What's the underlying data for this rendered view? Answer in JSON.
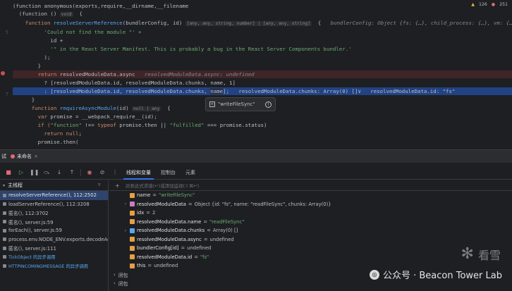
{
  "editor": {
    "status": {
      "warnings": "126",
      "errors": "251"
    },
    "line_numbers": [
      "",
      "",
      "5",
      "",
      "",
      "",
      "",
      "",
      "",
      "",
      "7",
      "",
      "",
      "",
      "",
      "",
      "",
      "",
      ""
    ],
    "lines": {
      "l1": "(function anonymous(exports,require,__dirname,__filename",
      "l2a": "  (function () ",
      "l2b": "void",
      "l2c": "  {",
      "l3a": "    function ",
      "l3b": "resolveServerReference",
      "l3c": "(bundlerConfig, id) ",
      "l3d": "[any, any, string, number] | [any, any, string]",
      "l3e": "  {   ",
      "l3f": "bundlerConfig: Object {fs: {…}, child_process: {…}, vm: {…}, util: {…}, htt",
      "l4": "          'Could not find the module \"' +",
      "l5": "            id +",
      "l6": "            '\" in the React Server Manifest. This is probably a bug in the React Server Components bundler.'",
      "l7": "          );",
      "l8": "        }",
      "l9a": "        return ",
      "l9b": "resolvedModuleData.async",
      "l9c": "   resolvedModuleData.async: undefined",
      "l10": "          ? [resolvedModuleData.id, resolvedModuleData.chunks, name, 1]",
      "l11a": "          : [resolvedModuleData.id, resolvedModuleData.chunks, ",
      "l11b": "name",
      "l11c": "];   resolvedModuleData.chunks: Array(0) []∨   resolvedModuleData.id: \"fs\"",
      "l12": "      }",
      "l13a": "      function ",
      "l13b": "requireAsyncModule",
      "l13c": "(id) ",
      "l13d": "null | any",
      "l13e": "  {",
      "l14a": "        var ",
      "l14b": "promise = __webpack_require__(id);",
      "l15a": "        if (",
      "l15b": "\"function\"",
      "l15c": " !== ",
      "l15d": "typeof",
      "l15e": " promise.then || ",
      "l15f": "\"fulfilled\"",
      "l15g": " === promise.status)",
      "l16a": "          return ",
      "l16b": "null",
      "l16c": ";",
      "l17": "        promise.then("
    },
    "tooltip": {
      "text": "\"writeFileSync\"",
      "icon": "string-value-icon",
      "info": "!"
    }
  },
  "debug": {
    "title": "试",
    "run_tab": "未命名",
    "tabs": [
      "线程和变量",
      "控制台",
      "元素"
    ],
    "frames_header": "主线程",
    "frames": [
      {
        "label": "resolveServerReference(), 112:2502",
        "selected": true,
        "async": false
      },
      {
        "label": "loadServerReference(), 112:3208",
        "selected": false,
        "async": false
      },
      {
        "label": "匿名(), 112:3702",
        "selected": false,
        "async": false
      },
      {
        "label": "匿名(), server.js:59",
        "selected": false,
        "async": false
      },
      {
        "label": "forEach(), server.js:59",
        "selected": false,
        "async": false
      },
      {
        "label": "process.env.NODE_ENV.exports.decodeActio",
        "selected": false,
        "async": false
      },
      {
        "label": "匿名(), server.js:111",
        "selected": false,
        "async": false
      },
      {
        "label": "TickObject 的异步调用",
        "selected": false,
        "async": true
      },
      {
        "label": "HTTPINCOMINGMESSAGE 的异步调用",
        "selected": false,
        "async": true
      }
    ],
    "watch_placeholder": "对表达式求值(↵)或添加监视(⇧⌘↵)",
    "variables": [
      {
        "expand": "",
        "icon": "var",
        "name": "name",
        "value": "\"writeFileSync\"",
        "kind": "str"
      },
      {
        "expand": "›",
        "icon": "obj",
        "name": "resolvedModuleData",
        "value": "Object {id: \"fs\", name: \"readFileSync\", chunks: Array(0)}",
        "kind": "obj"
      },
      {
        "expand": "",
        "icon": "var",
        "name": "idx",
        "value": "2",
        "kind": "num"
      },
      {
        "expand": "",
        "icon": "var",
        "name": "resolvedModuleData.name",
        "value": "\"readFileSync\"",
        "kind": "str"
      },
      {
        "expand": "›",
        "icon": "arr",
        "name": "resolvedModuleData.chunks",
        "value": "Array(0) []",
        "kind": "obj"
      },
      {
        "expand": "",
        "icon": "var",
        "name": "resolvedModuleData.async",
        "value": "undefined",
        "kind": "obj"
      },
      {
        "expand": "",
        "icon": "var",
        "name": "bundlerConfig[id]",
        "value": "undefined",
        "kind": "obj"
      },
      {
        "expand": "",
        "icon": "var",
        "name": "resolvedModuleData.id",
        "value": "\"fs\"",
        "kind": "str"
      },
      {
        "expand": "",
        "icon": "var",
        "name": "this",
        "value": "undefined",
        "kind": "obj"
      }
    ],
    "groups": [
      "闭包",
      "闭包"
    ]
  },
  "watermark": {
    "brand": "看雪",
    "wechat": "公众号 · Beacon Tower Lab"
  },
  "colors": {
    "accent": "#3574f0",
    "error": "#c94f4f",
    "string": "#6aab73",
    "keyword": "#cf8e6d",
    "function": "#56a8f5"
  }
}
